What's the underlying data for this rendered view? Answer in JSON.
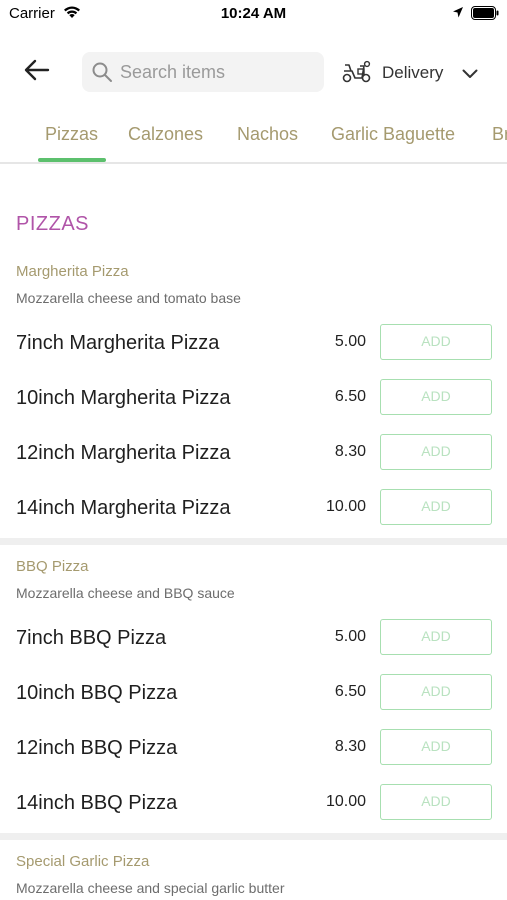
{
  "status": {
    "carrier": "Carrier",
    "time": "10:24 AM"
  },
  "header": {
    "search_placeholder": "Search items",
    "delivery_label": "Delivery"
  },
  "tabs": [
    {
      "label": "Pizzas",
      "active": true
    },
    {
      "label": "Calzones"
    },
    {
      "label": "Nachos"
    },
    {
      "label": "Garlic Baguette"
    },
    {
      "label": "Br"
    }
  ],
  "section": {
    "title": "PIZZAS"
  },
  "colors": {
    "accent_green": "#5cc06d",
    "section_title": "#b054a8",
    "group_name": "#a59a6f"
  },
  "groups": [
    {
      "name": "Margherita Pizza",
      "desc": "Mozzarella cheese and tomato base",
      "items": [
        {
          "name": "7inch Margherita Pizza",
          "price": "5.00",
          "add": "ADD"
        },
        {
          "name": "10inch Margherita Pizza",
          "price": "6.50",
          "add": "ADD"
        },
        {
          "name": "12inch Margherita Pizza",
          "price": "8.30",
          "add": "ADD"
        },
        {
          "name": "14inch Margherita Pizza",
          "price": "10.00",
          "add": "ADD"
        }
      ]
    },
    {
      "name": "BBQ Pizza",
      "desc": "Mozzarella cheese and BBQ sauce",
      "items": [
        {
          "name": "7inch BBQ Pizza",
          "price": "5.00",
          "add": "ADD"
        },
        {
          "name": "10inch BBQ Pizza",
          "price": "6.50",
          "add": "ADD"
        },
        {
          "name": "12inch BBQ Pizza",
          "price": "8.30",
          "add": "ADD"
        },
        {
          "name": "14inch BBQ Pizza",
          "price": "10.00",
          "add": "ADD"
        }
      ]
    },
    {
      "name": "Special Garlic Pizza",
      "desc": "Mozzarella cheese and special garlic butter"
    }
  ]
}
